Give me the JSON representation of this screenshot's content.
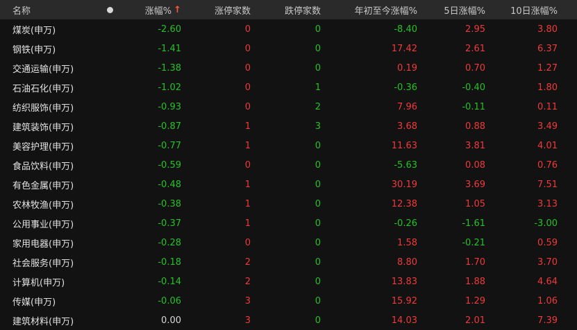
{
  "colors": {
    "up": "#f03a3a",
    "down": "#25c225",
    "flat": "#d8d8d8",
    "bg": "#121212",
    "header_bg": "#2a2a2a"
  },
  "header": {
    "name": "名称",
    "change_pct": "涨幅%",
    "sort_arrow": "↑",
    "limit_up": "涨停家数",
    "limit_down": "跌停家数",
    "ytd": "年初至今涨幅%",
    "d5": "5日涨幅%",
    "d10": "10日涨幅%"
  },
  "rows": [
    {
      "name": "煤炭(申万)",
      "chg": "-2.60",
      "lu": "0",
      "ld": "0",
      "ytd": "-8.40",
      "d5": "2.95",
      "d10": "3.80"
    },
    {
      "name": "钢铁(申万)",
      "chg": "-1.41",
      "lu": "0",
      "ld": "0",
      "ytd": "17.42",
      "d5": "2.61",
      "d10": "6.37"
    },
    {
      "name": "交通运输(申万)",
      "chg": "-1.38",
      "lu": "0",
      "ld": "0",
      "ytd": "0.19",
      "d5": "0.70",
      "d10": "1.27"
    },
    {
      "name": "石油石化(申万)",
      "chg": "-1.02",
      "lu": "0",
      "ld": "1",
      "ytd": "-0.36",
      "d5": "-0.40",
      "d10": "1.80"
    },
    {
      "name": "纺织服饰(申万)",
      "chg": "-0.93",
      "lu": "0",
      "ld": "2",
      "ytd": "7.96",
      "d5": "-0.11",
      "d10": "0.11"
    },
    {
      "name": "建筑装饰(申万)",
      "chg": "-0.87",
      "lu": "1",
      "ld": "3",
      "ytd": "3.68",
      "d5": "0.88",
      "d10": "3.49"
    },
    {
      "name": "美容护理(申万)",
      "chg": "-0.77",
      "lu": "1",
      "ld": "0",
      "ytd": "11.63",
      "d5": "3.81",
      "d10": "4.01"
    },
    {
      "name": "食品饮料(申万)",
      "chg": "-0.59",
      "lu": "0",
      "ld": "0",
      "ytd": "-5.63",
      "d5": "0.08",
      "d10": "0.76"
    },
    {
      "name": "有色金属(申万)",
      "chg": "-0.48",
      "lu": "1",
      "ld": "0",
      "ytd": "30.19",
      "d5": "3.69",
      "d10": "7.51"
    },
    {
      "name": "农林牧渔(申万)",
      "chg": "-0.38",
      "lu": "1",
      "ld": "0",
      "ytd": "12.38",
      "d5": "1.05",
      "d10": "3.13"
    },
    {
      "name": "公用事业(申万)",
      "chg": "-0.37",
      "lu": "1",
      "ld": "0",
      "ytd": "-0.26",
      "d5": "-1.61",
      "d10": "-3.00"
    },
    {
      "name": "家用电器(申万)",
      "chg": "-0.28",
      "lu": "0",
      "ld": "0",
      "ytd": "1.58",
      "d5": "-0.21",
      "d10": "0.59"
    },
    {
      "name": "社会服务(申万)",
      "chg": "-0.18",
      "lu": "2",
      "ld": "0",
      "ytd": "8.80",
      "d5": "1.70",
      "d10": "3.70"
    },
    {
      "name": "计算机(申万)",
      "chg": "-0.14",
      "lu": "2",
      "ld": "0",
      "ytd": "13.83",
      "d5": "1.88",
      "d10": "4.64"
    },
    {
      "name": "传媒(申万)",
      "chg": "-0.06",
      "lu": "3",
      "ld": "0",
      "ytd": "15.92",
      "d5": "1.29",
      "d10": "1.06"
    },
    {
      "name": "建筑材料(申万)",
      "chg": "0.00",
      "lu": "3",
      "ld": "0",
      "ytd": "14.03",
      "d5": "2.01",
      "d10": "7.39"
    }
  ]
}
